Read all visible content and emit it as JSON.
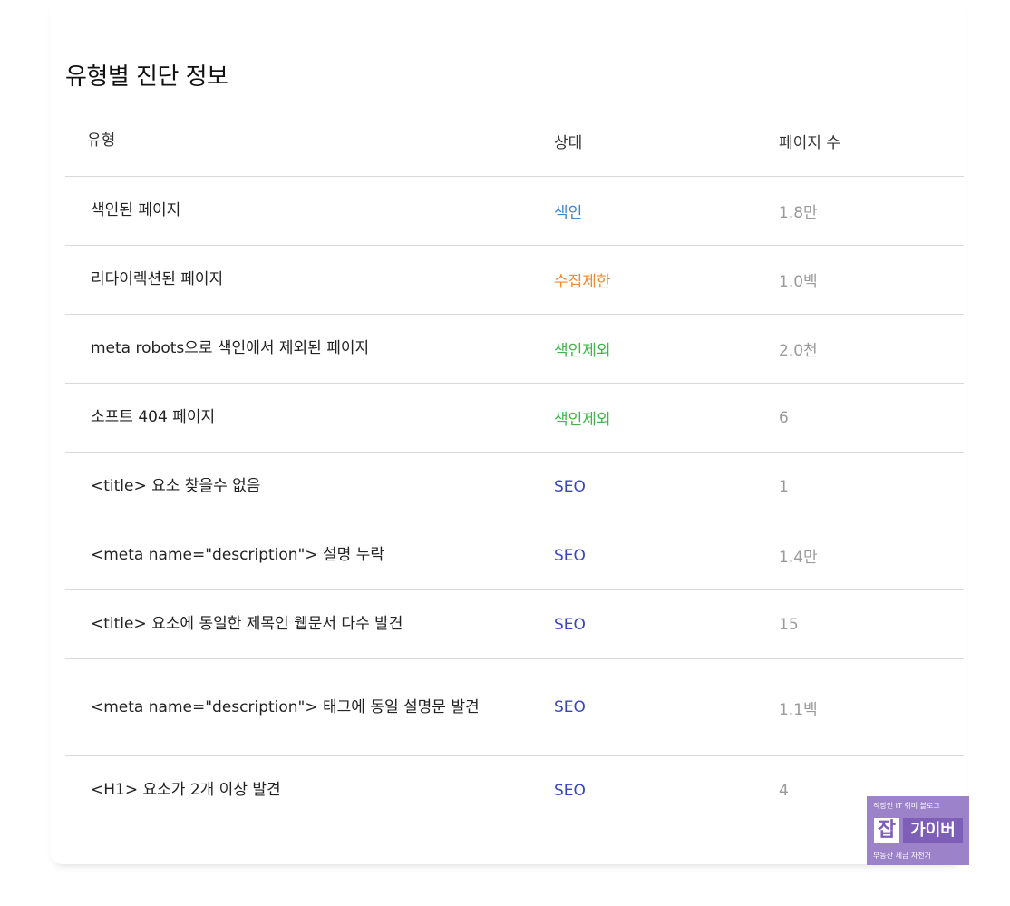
{
  "section": {
    "title": "유형별 진단 정보"
  },
  "table": {
    "headers": {
      "type": "유형",
      "status": "상태",
      "count": "페이지 수"
    },
    "rows": [
      {
        "type": "색인된 페이지",
        "status": "색인",
        "status_color": "#3b86d6",
        "count": "1.8만"
      },
      {
        "type": "리다이렉션된 페이지",
        "status": "수집제한",
        "status_color": "#f08a2c",
        "count": "1.0백"
      },
      {
        "type": "meta robots으로 색인에서 제외된 페이지",
        "status": "색인제외",
        "status_color": "#3fb54a",
        "count": "2.0천"
      },
      {
        "type": "소프트 404 페이지",
        "status": "색인제외",
        "status_color": "#3fb54a",
        "count": "6"
      },
      {
        "type": "<title> 요소 찾을수 없음",
        "status": "SEO",
        "status_color": "#3745c4",
        "count": "1"
      },
      {
        "type": "<meta name=\"description\"> 설명 누락",
        "status": "SEO",
        "status_color": "#3745c4",
        "count": "1.4만"
      },
      {
        "type": "<title> 요소에 동일한 제목인 웹문서 다수 발견",
        "status": "SEO",
        "status_color": "#3745c4",
        "count": "15"
      },
      {
        "type": "<meta name=\"description\"> 태그에 동일 설명문 발견",
        "status": "SEO",
        "status_color": "#3745c4",
        "count": "1.1백"
      },
      {
        "type": "<H1> 요소가 2개 이상 발견",
        "status": "SEO",
        "status_color": "#3745c4",
        "count": "4"
      }
    ]
  },
  "watermark": {
    "top_text": "직장인 IT 취미 블로그",
    "char": "잡",
    "name": "가이버",
    "bottom_text": "부동산 세금 자전거"
  }
}
